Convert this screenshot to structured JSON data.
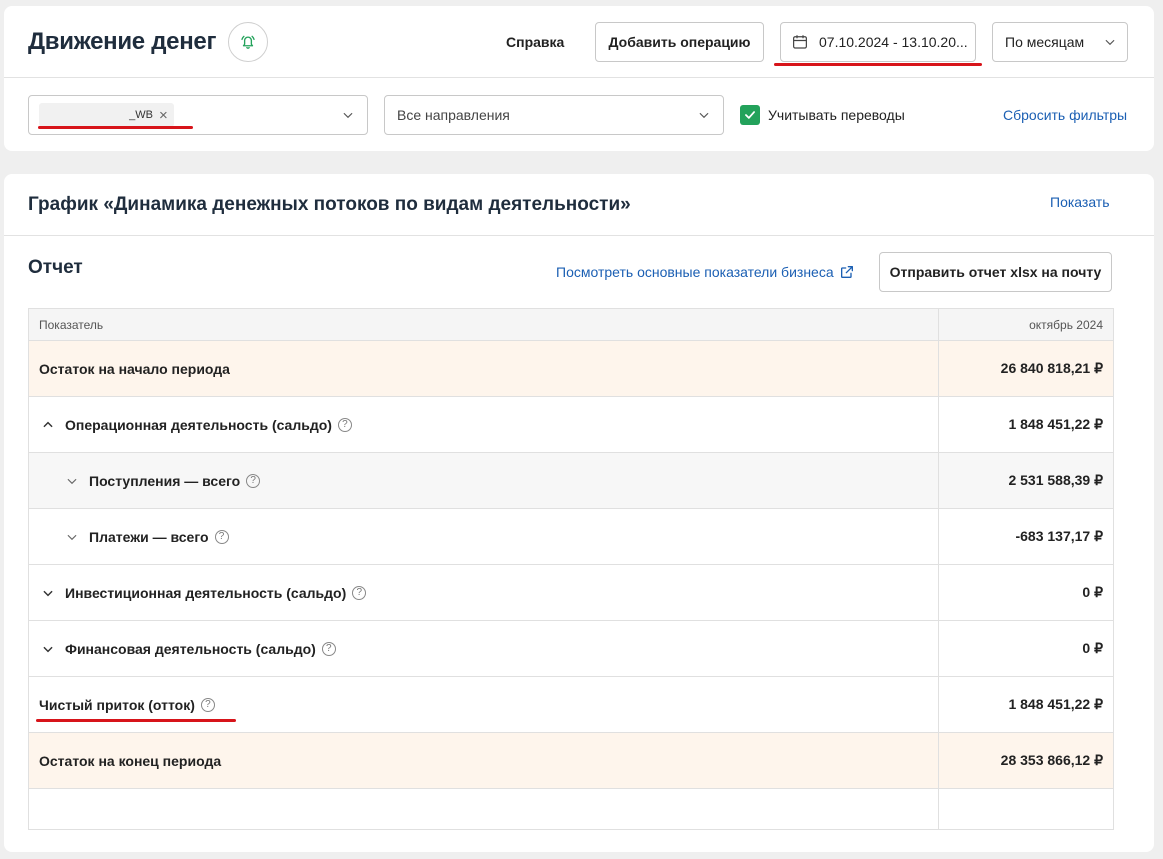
{
  "header": {
    "title": "Движение денег",
    "help_label": "Справка",
    "add_operation_label": "Добавить операцию",
    "date_range": "07.10.2024 - 13.10.20...",
    "period_select": "По месяцам"
  },
  "filters": {
    "account_chip": "_WB",
    "direction_placeholder": "Все направления",
    "include_transfers_label": "Учитывать переводы",
    "include_transfers_checked": true,
    "reset_label": "Сбросить фильтры"
  },
  "chart_section": {
    "title": "График «Динамика денежных потоков по видам деятельности»",
    "show_label": "Показать"
  },
  "report": {
    "title": "Отчет",
    "kpi_link": "Посмотреть основные показатели бизнеса",
    "send_button": "Отправить отчет xlsx на почту",
    "columns": [
      "Показатель",
      "октябрь 2024"
    ],
    "rows": [
      {
        "label": "Остаток на начало периода",
        "value": "26 840 818,21 ₽"
      },
      {
        "label": "Операционная деятельность (сальдо)",
        "value": "1 848 451,22 ₽"
      },
      {
        "label": "Поступления — всего",
        "value": "2 531 588,39 ₽"
      },
      {
        "label": "Платежи — всего",
        "value": "-683 137,17 ₽"
      },
      {
        "label": "Инвестиционная деятельность (сальдо)",
        "value": "0 ₽"
      },
      {
        "label": "Финансовая деятельность (сальдо)",
        "value": "0 ₽"
      },
      {
        "label": "Чистый приток (отток)",
        "value": "1 848 451,22 ₽"
      },
      {
        "label": "Остаток на конец периода",
        "value": "28 353 866,12 ₽"
      }
    ]
  },
  "colors": {
    "accent_link": "#1b5fb3",
    "checkbox": "#23a25b",
    "highlight_row": "#fef5ec",
    "annotation_underline": "#d7141a"
  }
}
